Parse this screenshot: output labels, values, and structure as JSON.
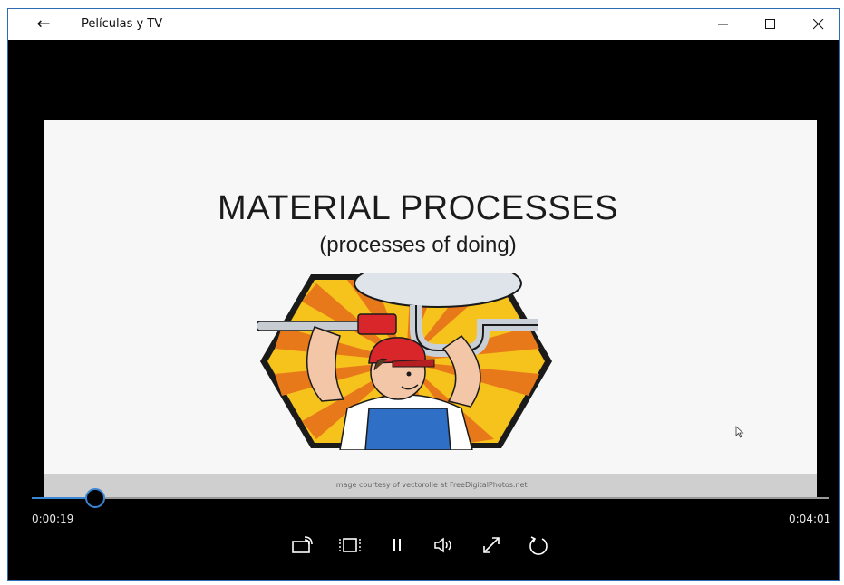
{
  "window": {
    "title": "Películas y TV"
  },
  "slide": {
    "title": "MATERIAL PROCESSES",
    "subtitle": "(processes of doing)",
    "courtesy": "Image courtesy of vectorolie at FreeDigitalPhotos.net"
  },
  "playback": {
    "elapsed": "0:00:19",
    "total": "0:04:01",
    "progress_fraction": 0.079
  },
  "controls": [
    {
      "name": "cast-to-device-button",
      "icon": "cast-icon"
    },
    {
      "name": "aspect-ratio-button",
      "icon": "aspect-ratio-icon"
    },
    {
      "name": "pause-button",
      "icon": "pause-icon"
    },
    {
      "name": "volume-button",
      "icon": "volume-icon"
    },
    {
      "name": "fullscreen-button",
      "icon": "expand-icon"
    },
    {
      "name": "repeat-button",
      "icon": "repeat-icon"
    }
  ],
  "colors": {
    "accent": "#3a86d4",
    "video_bg": "#000000"
  }
}
